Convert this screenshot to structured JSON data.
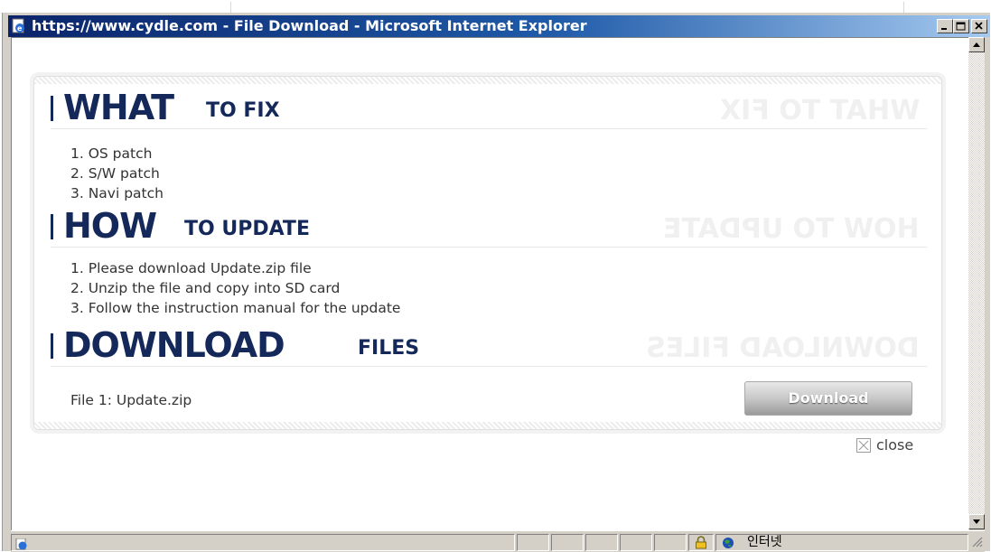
{
  "window": {
    "title": "https://www.cydle.com - File Download - Microsoft Internet Explorer",
    "icons": {
      "title": "ie-page-icon",
      "minimize": "minimize-icon",
      "maximize": "maximize-icon",
      "close": "window-close-icon"
    }
  },
  "sections": {
    "what": {
      "title_big": "WHAT",
      "title_small": "TO FIX",
      "ghost": "WHAT TO FIX",
      "items": [
        "1. OS patch",
        "2. S/W patch",
        "3. Navi patch"
      ]
    },
    "how": {
      "title_big": "HOW",
      "title_small": "TO UPDATE",
      "ghost": "HOW TO UPDATE",
      "items": [
        "1. Please download Update.zip file",
        "2. Unzip the file and copy into SD card",
        "3. Follow the instruction manual for the update"
      ]
    },
    "download": {
      "title_big": "DOWNLOAD",
      "title_small": "FILES",
      "ghost": "DOWNLOAD FILES",
      "file_label": "File 1: Update.zip",
      "button_label": "Download"
    }
  },
  "close": {
    "label": "close",
    "icon": "close-box-icon"
  },
  "statusbar": {
    "zone_text": "인터넷",
    "icons": [
      "ie-logo-icon",
      "lock-icon",
      "globe-icon"
    ]
  },
  "colors": {
    "heading": "#15285a",
    "titlebar_start": "#0a246a",
    "titlebar_end": "#a6caf0",
    "chrome": "#d4d0c8"
  }
}
